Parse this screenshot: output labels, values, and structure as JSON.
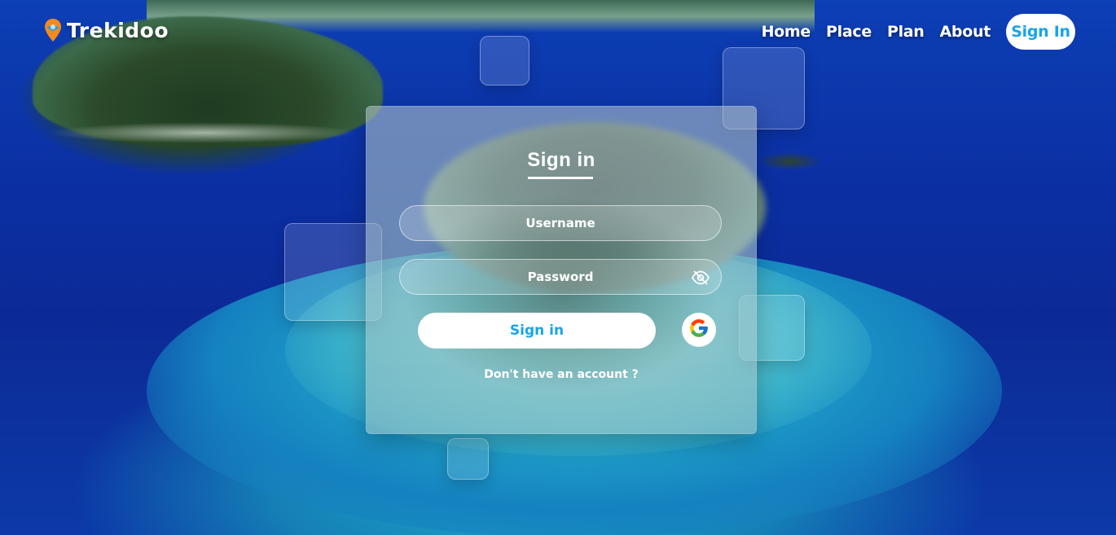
{
  "brand": {
    "name": "Trekidoo",
    "icon": "map-pin-icon"
  },
  "nav": {
    "links": [
      {
        "label": "Home"
      },
      {
        "label": "Place"
      },
      {
        "label": "Plan"
      },
      {
        "label": "About"
      }
    ],
    "signin_label": "Sign In"
  },
  "form": {
    "title": "Sign in",
    "username_placeholder": "Username",
    "password_placeholder": "Password",
    "password_toggle_icon": "eye-off-icon",
    "submit_label": "Sign in",
    "google_icon": "google-icon",
    "signup_text": "Don't have an account ?"
  },
  "colors": {
    "accent": "#1aa3e8",
    "white": "#ffffff"
  }
}
